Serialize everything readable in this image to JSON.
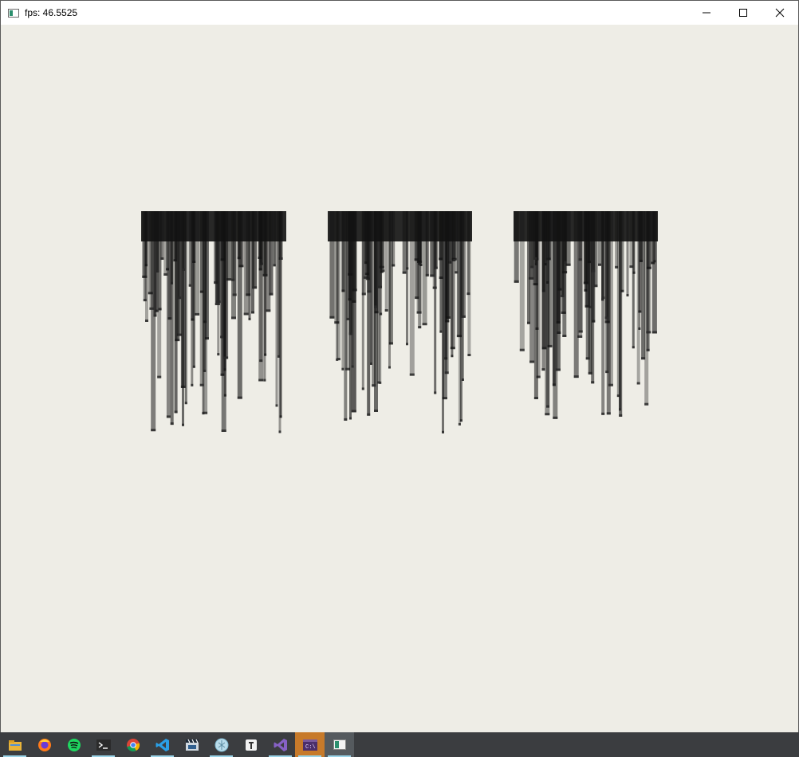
{
  "window": {
    "title": "fps: 46.5525"
  },
  "taskbar": {
    "items": [
      {
        "name": "file-explorer-icon",
        "running": true
      },
      {
        "name": "firefox-icon",
        "running": false
      },
      {
        "name": "spotify-icon",
        "running": false
      },
      {
        "name": "terminal-icon",
        "running": true
      },
      {
        "name": "chrome-icon",
        "running": false
      },
      {
        "name": "vscode-icon",
        "running": true
      },
      {
        "name": "clapperboard-icon",
        "running": false
      },
      {
        "name": "app-globe-icon",
        "running": true
      },
      {
        "name": "notes-icon",
        "running": false
      },
      {
        "name": "visual-studio-icon",
        "running": true
      },
      {
        "name": "console-app-icon",
        "running": true
      },
      {
        "name": "render-window-icon",
        "running": true
      }
    ]
  },
  "colors": {
    "canvas_bg": "#eeede6",
    "bar_fill": "#121212",
    "taskbar_bg": "#3b3d40"
  }
}
